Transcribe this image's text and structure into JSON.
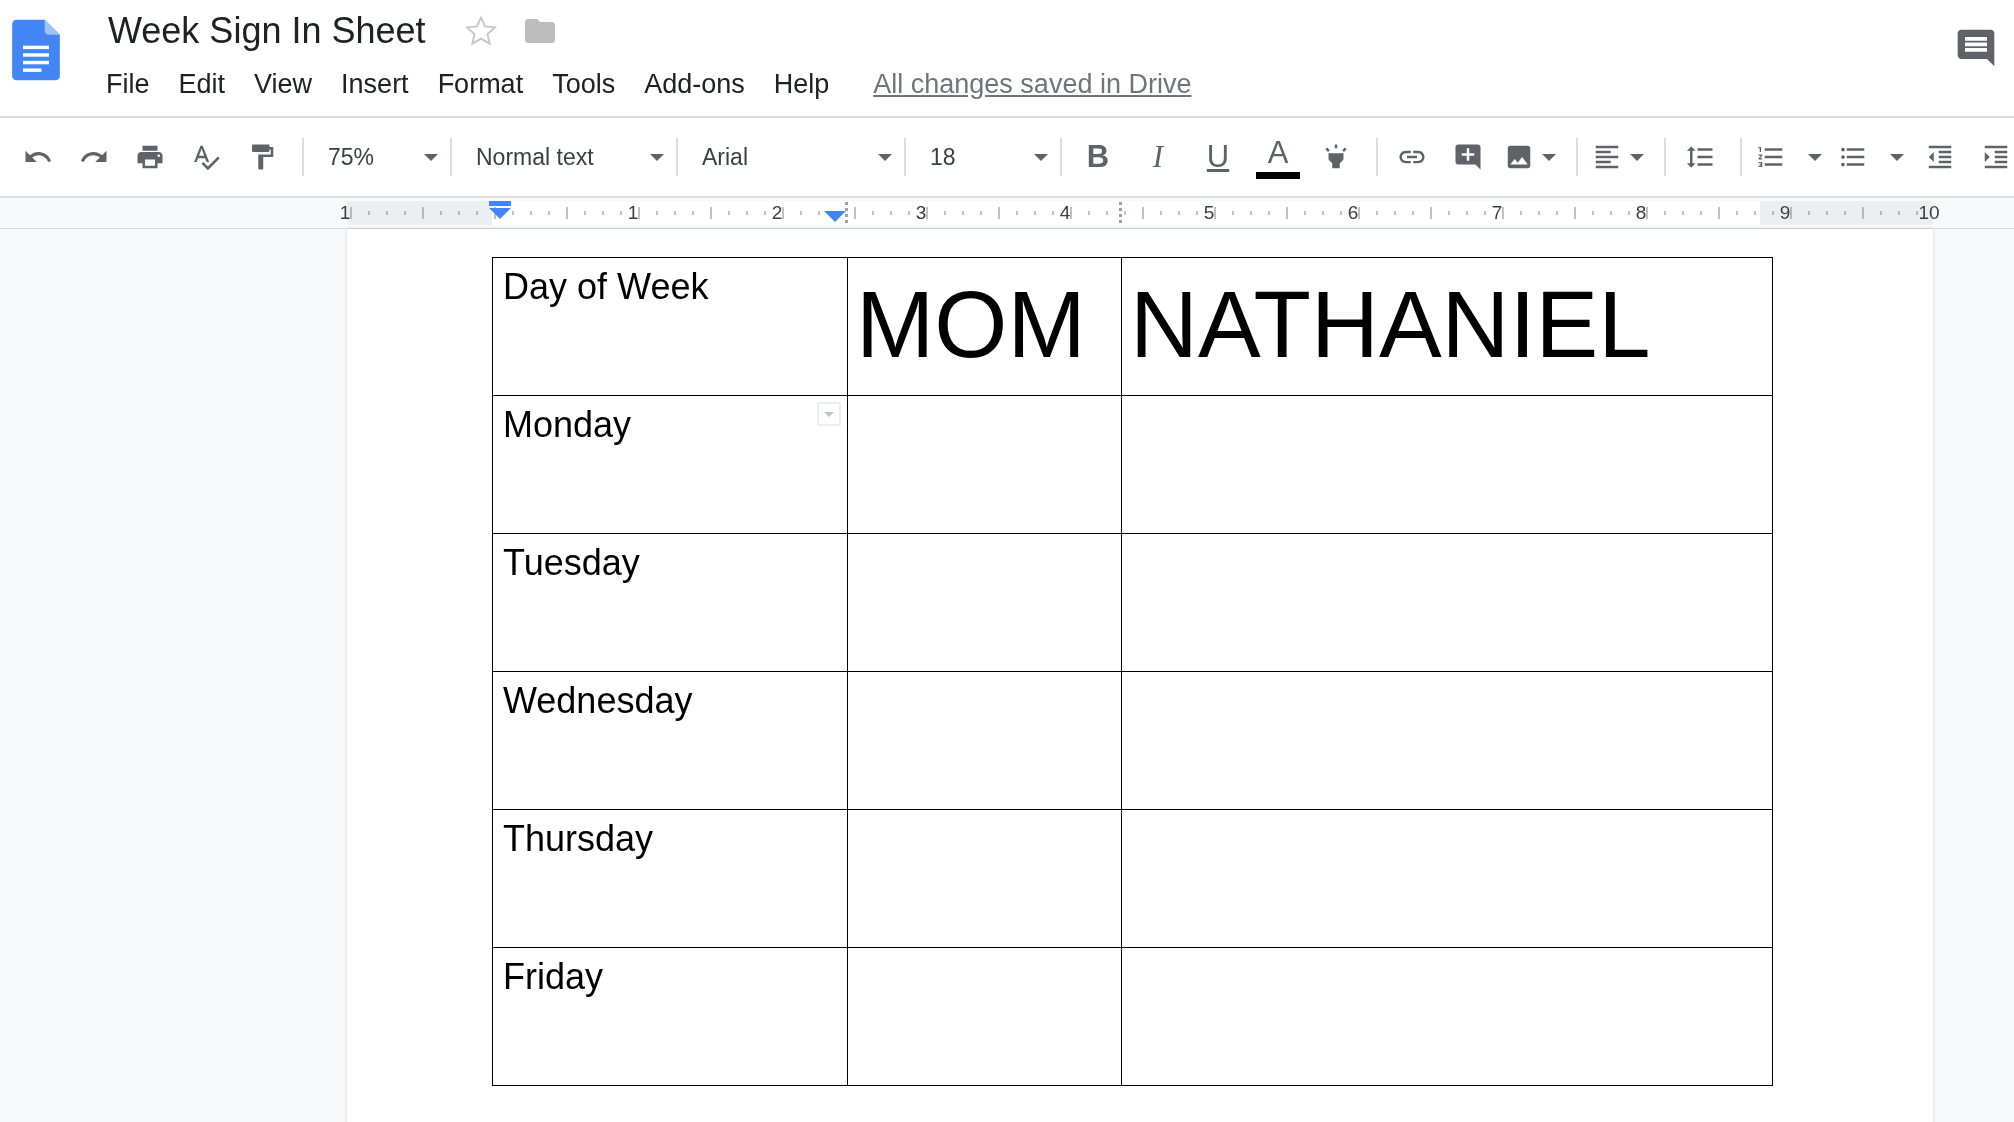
{
  "app": {
    "title": "Week Sign In Sheet",
    "starred": false,
    "menu": [
      "File",
      "Edit",
      "View",
      "Insert",
      "Format",
      "Tools",
      "Add-ons",
      "Help"
    ],
    "save_status": "All changes saved in Drive"
  },
  "toolbar": {
    "zoom": "75%",
    "style": "Normal text",
    "font": "Arial",
    "size": "18",
    "format_keys": [
      "B",
      "I",
      "U",
      "A"
    ]
  },
  "ruler": {
    "labels": [
      "1",
      "1",
      "2",
      "3",
      "4",
      "5",
      "6",
      "7",
      "8",
      "9",
      "10"
    ]
  },
  "table": {
    "columns": [
      "Day of Week",
      "MOM",
      "NATHANIEL"
    ],
    "rows": [
      {
        "day": "Monday"
      },
      {
        "day": "Tuesday"
      },
      {
        "day": "Wednesday"
      },
      {
        "day": "Thursday"
      },
      {
        "day": "Friday"
      }
    ]
  }
}
